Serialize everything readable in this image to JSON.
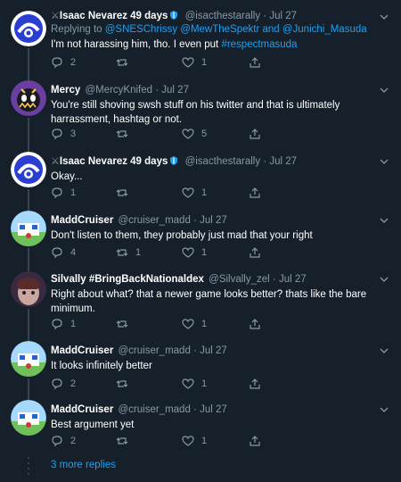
{
  "thread": {
    "more_replies": "3 more replies",
    "tweets": [
      {
        "name": "Isaac Nevarez 49 days",
        "handle": "@isacthestarally",
        "date": "Jul 27",
        "replying_label": "Replying to",
        "replying_to": "@SNESChrissy @MewTheSpektr and @Junichi_Masuda",
        "text_before": "I'm not harassing him, tho. I even put ",
        "hashtag": "#respectmasuda",
        "replies": "2",
        "retweets": "",
        "likes": "1"
      },
      {
        "name": "Mercy",
        "handle": "@MercyKnifed",
        "date": "Jul 27",
        "text": "You're still shoving swsh stuff on his twitter and that is ultimately harrassment, hashtag or not.",
        "replies": "3",
        "retweets": "",
        "likes": "5"
      },
      {
        "name": "Isaac Nevarez 49 days",
        "handle": "@isacthestarally",
        "date": "Jul 27",
        "text": "Okay...",
        "replies": "1",
        "retweets": "",
        "likes": "1"
      },
      {
        "name": "MaddCruiser",
        "handle": "@cruiser_madd",
        "date": "Jul 27",
        "text": "Don't listen to them, they probably just mad that your right",
        "replies": "4",
        "retweets": "1",
        "likes": "1"
      },
      {
        "name": "Silvally #BringBackNationaldex",
        "handle": "@Silvally_zel",
        "date": "Jul 27",
        "text": "Right about what? that a newer game looks better? thats  like the bare minimum.",
        "replies": "1",
        "retweets": "",
        "likes": "1"
      },
      {
        "name": "MaddCruiser",
        "handle": "@cruiser_madd",
        "date": "Jul 27",
        "text": "It looks infinitely better",
        "replies": "2",
        "retweets": "",
        "likes": "1"
      },
      {
        "name": "MaddCruiser",
        "handle": "@cruiser_madd",
        "date": "Jul 27",
        "text": "Best argument yet",
        "replies": "2",
        "retweets": "",
        "likes": "1"
      }
    ]
  },
  "icons": {
    "reply": "reply-icon",
    "retweet": "retweet-icon",
    "like": "heart-icon",
    "share": "share-icon",
    "more": "chevron-down-icon"
  },
  "colors": {
    "background": "#15202b",
    "text": "#ffffff",
    "muted": "#8899a6",
    "link": "#1da1f2",
    "thread_line": "#38444d"
  }
}
